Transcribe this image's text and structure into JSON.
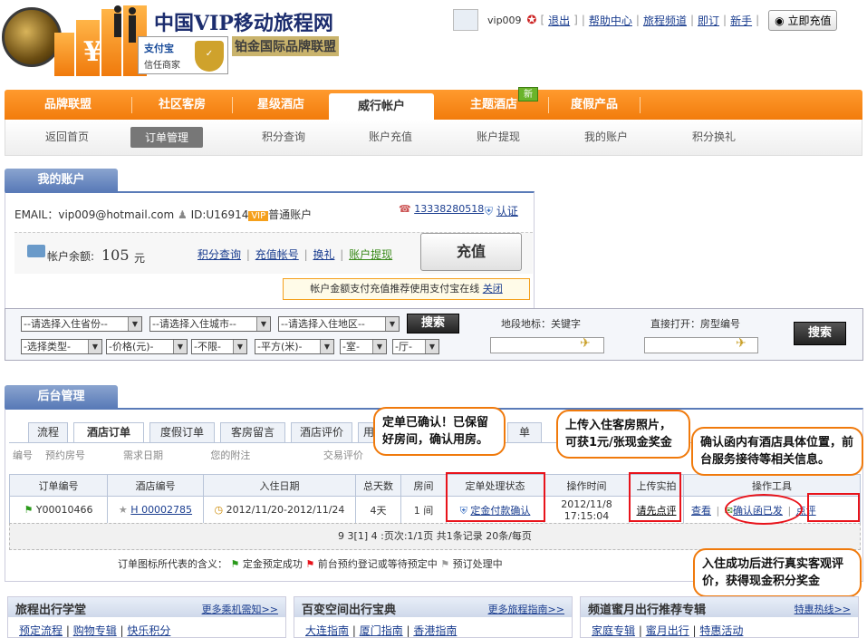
{
  "header": {
    "brand_title": "中国VIP移动旅程网",
    "brand_sub": "铂金国际品牌联盟",
    "alipay_line1": "支付宝",
    "alipay_line2": "信任商家",
    "username": "vip009",
    "links": [
      "退出",
      "帮助中心",
      "旅程频道",
      "即订",
      "新手"
    ],
    "recharge": "立即充值"
  },
  "mainnav": {
    "items": [
      "品牌联盟",
      "社区客房",
      "星级酒店",
      "威行帐户",
      "主题酒店",
      "度假产品"
    ],
    "active_index": 3,
    "new_badge": "新"
  },
  "subnav": {
    "items": [
      "返回首页",
      "订单管理",
      "积分查询",
      "账户充值",
      "账户提现",
      "我的账户",
      "积分换礼"
    ],
    "active_index": 1
  },
  "account": {
    "tab": "我的账户",
    "email_label": "EMAIL：vip009@hotmail.com",
    "id_label": "ID:U16914",
    "vip_badge": "VIP",
    "account_type": "普通账户",
    "phone": "13338280518",
    "cert": "认证",
    "balance_label": "帐户余额:",
    "balance_value": "105",
    "balance_unit": "元",
    "links": [
      "积分查询",
      "充值帐号",
      "换礼",
      "账户提现"
    ],
    "charge_button": "充值",
    "tip_text": "帐户金额支付充值推荐使用支付宝在线",
    "tip_close": "关闭"
  },
  "search": {
    "row1_selects": [
      "--请选择入住省份--",
      "--请选择入住城市--",
      "--请选择入住地区--"
    ],
    "row2_selects": [
      "-选择类型-",
      "-价格(元)-",
      "-不限-",
      "-平方(米)-",
      "-室-",
      "-厅-"
    ],
    "search_btn_1": "搜索",
    "landmark_label": "地段地标：关键字",
    "direct_label": "直接打开：房型编号",
    "search_btn_2": "搜索"
  },
  "backend": {
    "tab": "后台管理",
    "tabs": [
      "流程",
      "酒店订单",
      "度假订单",
      "客房留言",
      "酒店评价",
      "用",
      "单"
    ],
    "active_tab": 1,
    "sort_row": [
      "编号",
      "预约房号",
      "需求日期",
      "您的附注",
      "交易评价"
    ],
    "columns": [
      "订单编号",
      "酒店编号",
      "入住日期",
      "总天数",
      "房间",
      "定单处理状态",
      "操作时间",
      "上传实拍",
      "操作工具"
    ],
    "row": {
      "order_no": "Y00010466",
      "hotel_no": "H 00002785",
      "dates": "2012/11/20-2012/11/24",
      "days": "4天",
      "rooms": "1 间",
      "status": "定金付款确认",
      "time_line1": "2012/11/8",
      "time_line2": "17:15:04",
      "upload": "请先点评",
      "tool_view": "查看",
      "tool_confirm": "确认函已发",
      "tool_review": "点评"
    },
    "pager": "9 3[1] 4 :页次:1/1页 共1条记录 20条/每页",
    "legend_label": "订单图标所代表的含义：",
    "legend_items": [
      "定金预定成功",
      "前台预约登记或等待预定中",
      "预订处理中"
    ],
    "callouts": {
      "c1": "定单已确认！已保留好房间，确认用房。",
      "c2": "上传入住客房照片，可获1元/张现金奖金",
      "c3": "确认函内有酒店具体位置，前台服务接待等相关信息。",
      "c4": "入住成功后进行真实客观评价，获得现金积分奖金"
    }
  },
  "bottom": [
    {
      "title": "旅程出行学堂",
      "more": "更多乘机需知>>",
      "links": [
        "预定流程",
        "购物专辑",
        "快乐积分"
      ]
    },
    {
      "title": "百变空间出行宝典",
      "more": "更多旅程指南>>",
      "links": [
        "大连指南",
        "厦门指南",
        "香港指南"
      ]
    },
    {
      "title": "频道蜜月出行推荐专辑",
      "more": "特惠热线>>",
      "links": [
        "家庭专辑",
        "蜜月出行",
        "特惠活动"
      ]
    }
  ],
  "colors": {
    "orange": "#f27c0c",
    "blue": "#5a7bb8",
    "red": "#e8131b"
  }
}
